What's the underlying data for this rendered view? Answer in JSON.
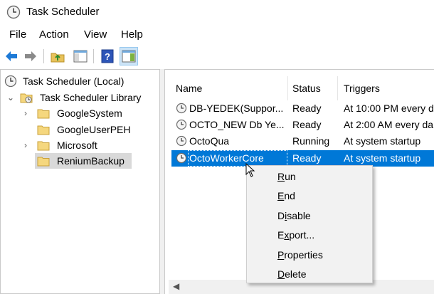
{
  "window": {
    "title": "Task Scheduler"
  },
  "menu": [
    {
      "label": "File"
    },
    {
      "label": "Action"
    },
    {
      "label": "View"
    },
    {
      "label": "Help"
    }
  ],
  "toolbar": {
    "icons": [
      "back-arrow-icon",
      "forward-arrow-icon",
      "folder-up-icon",
      "show-hide-console-tree-icon",
      "help-icon",
      "show-hide-action-pane-icon"
    ]
  },
  "tree": {
    "root": "Task Scheduler (Local)",
    "library": "Task Scheduler Library",
    "items": [
      {
        "label": "GoogleSystem",
        "expandable": true
      },
      {
        "label": "GoogleUserPEH",
        "expandable": false
      },
      {
        "label": "Microsoft",
        "expandable": true
      },
      {
        "label": "ReniumBackup",
        "expandable": false,
        "selected": true
      }
    ]
  },
  "table": {
    "columns": [
      "Name",
      "Status",
      "Triggers"
    ],
    "rows": [
      {
        "name": "DB-YEDEK(Suppor...",
        "status": "Ready",
        "trigger": "At 10:00 PM every d"
      },
      {
        "name": "OCTO_NEW Db Ye...",
        "status": "Ready",
        "trigger": "At 2:00 AM every da"
      },
      {
        "name": "OctoQua",
        "status": "Running",
        "trigger": "At system startup"
      },
      {
        "name": "OctoWorkerCore",
        "status": "Ready",
        "trigger": "At system startup",
        "selected": true
      }
    ]
  },
  "context_menu": {
    "items": [
      {
        "prefix": "",
        "hot": "R",
        "rest": "un"
      },
      {
        "prefix": "",
        "hot": "E",
        "rest": "nd"
      },
      {
        "prefix": "D",
        "hot": "i",
        "rest": "sable"
      },
      {
        "prefix": "E",
        "hot": "x",
        "rest": "port..."
      },
      {
        "prefix": "",
        "hot": "P",
        "rest": "roperties"
      },
      {
        "prefix": "",
        "hot": "D",
        "rest": "elete"
      }
    ]
  },
  "colors": {
    "selection": "#0078d7",
    "selected_tree_bg": "#d9d9d9",
    "menu_bg": "#f2f2f2"
  }
}
